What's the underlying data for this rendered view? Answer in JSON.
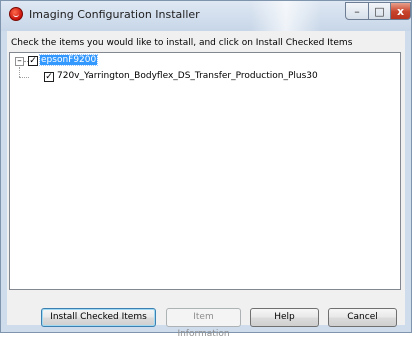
{
  "window": {
    "title": "Imaging Configuration Installer",
    "controls": {
      "minimize": "–",
      "maximize": "□",
      "close": "x"
    }
  },
  "instruction": "Check the items you would like to install, and click on Install Checked Items",
  "tree": {
    "expander": "–",
    "root": {
      "label": "epsonF9200",
      "checked": true,
      "selected": true,
      "check_glyph": "✓"
    },
    "children": [
      {
        "label": "720v_Yarrington_Bodyflex_DS_Transfer_Production_Plus30",
        "checked": true,
        "check_glyph": "✓"
      }
    ]
  },
  "buttons": {
    "install": "Install Checked Items",
    "item_info": "Item Information",
    "help": "Help",
    "cancel": "Cancel"
  },
  "colors": {
    "selection": "#3399ff",
    "close_button": "#c8432b",
    "dialog_bg": "#f0f0f0"
  }
}
